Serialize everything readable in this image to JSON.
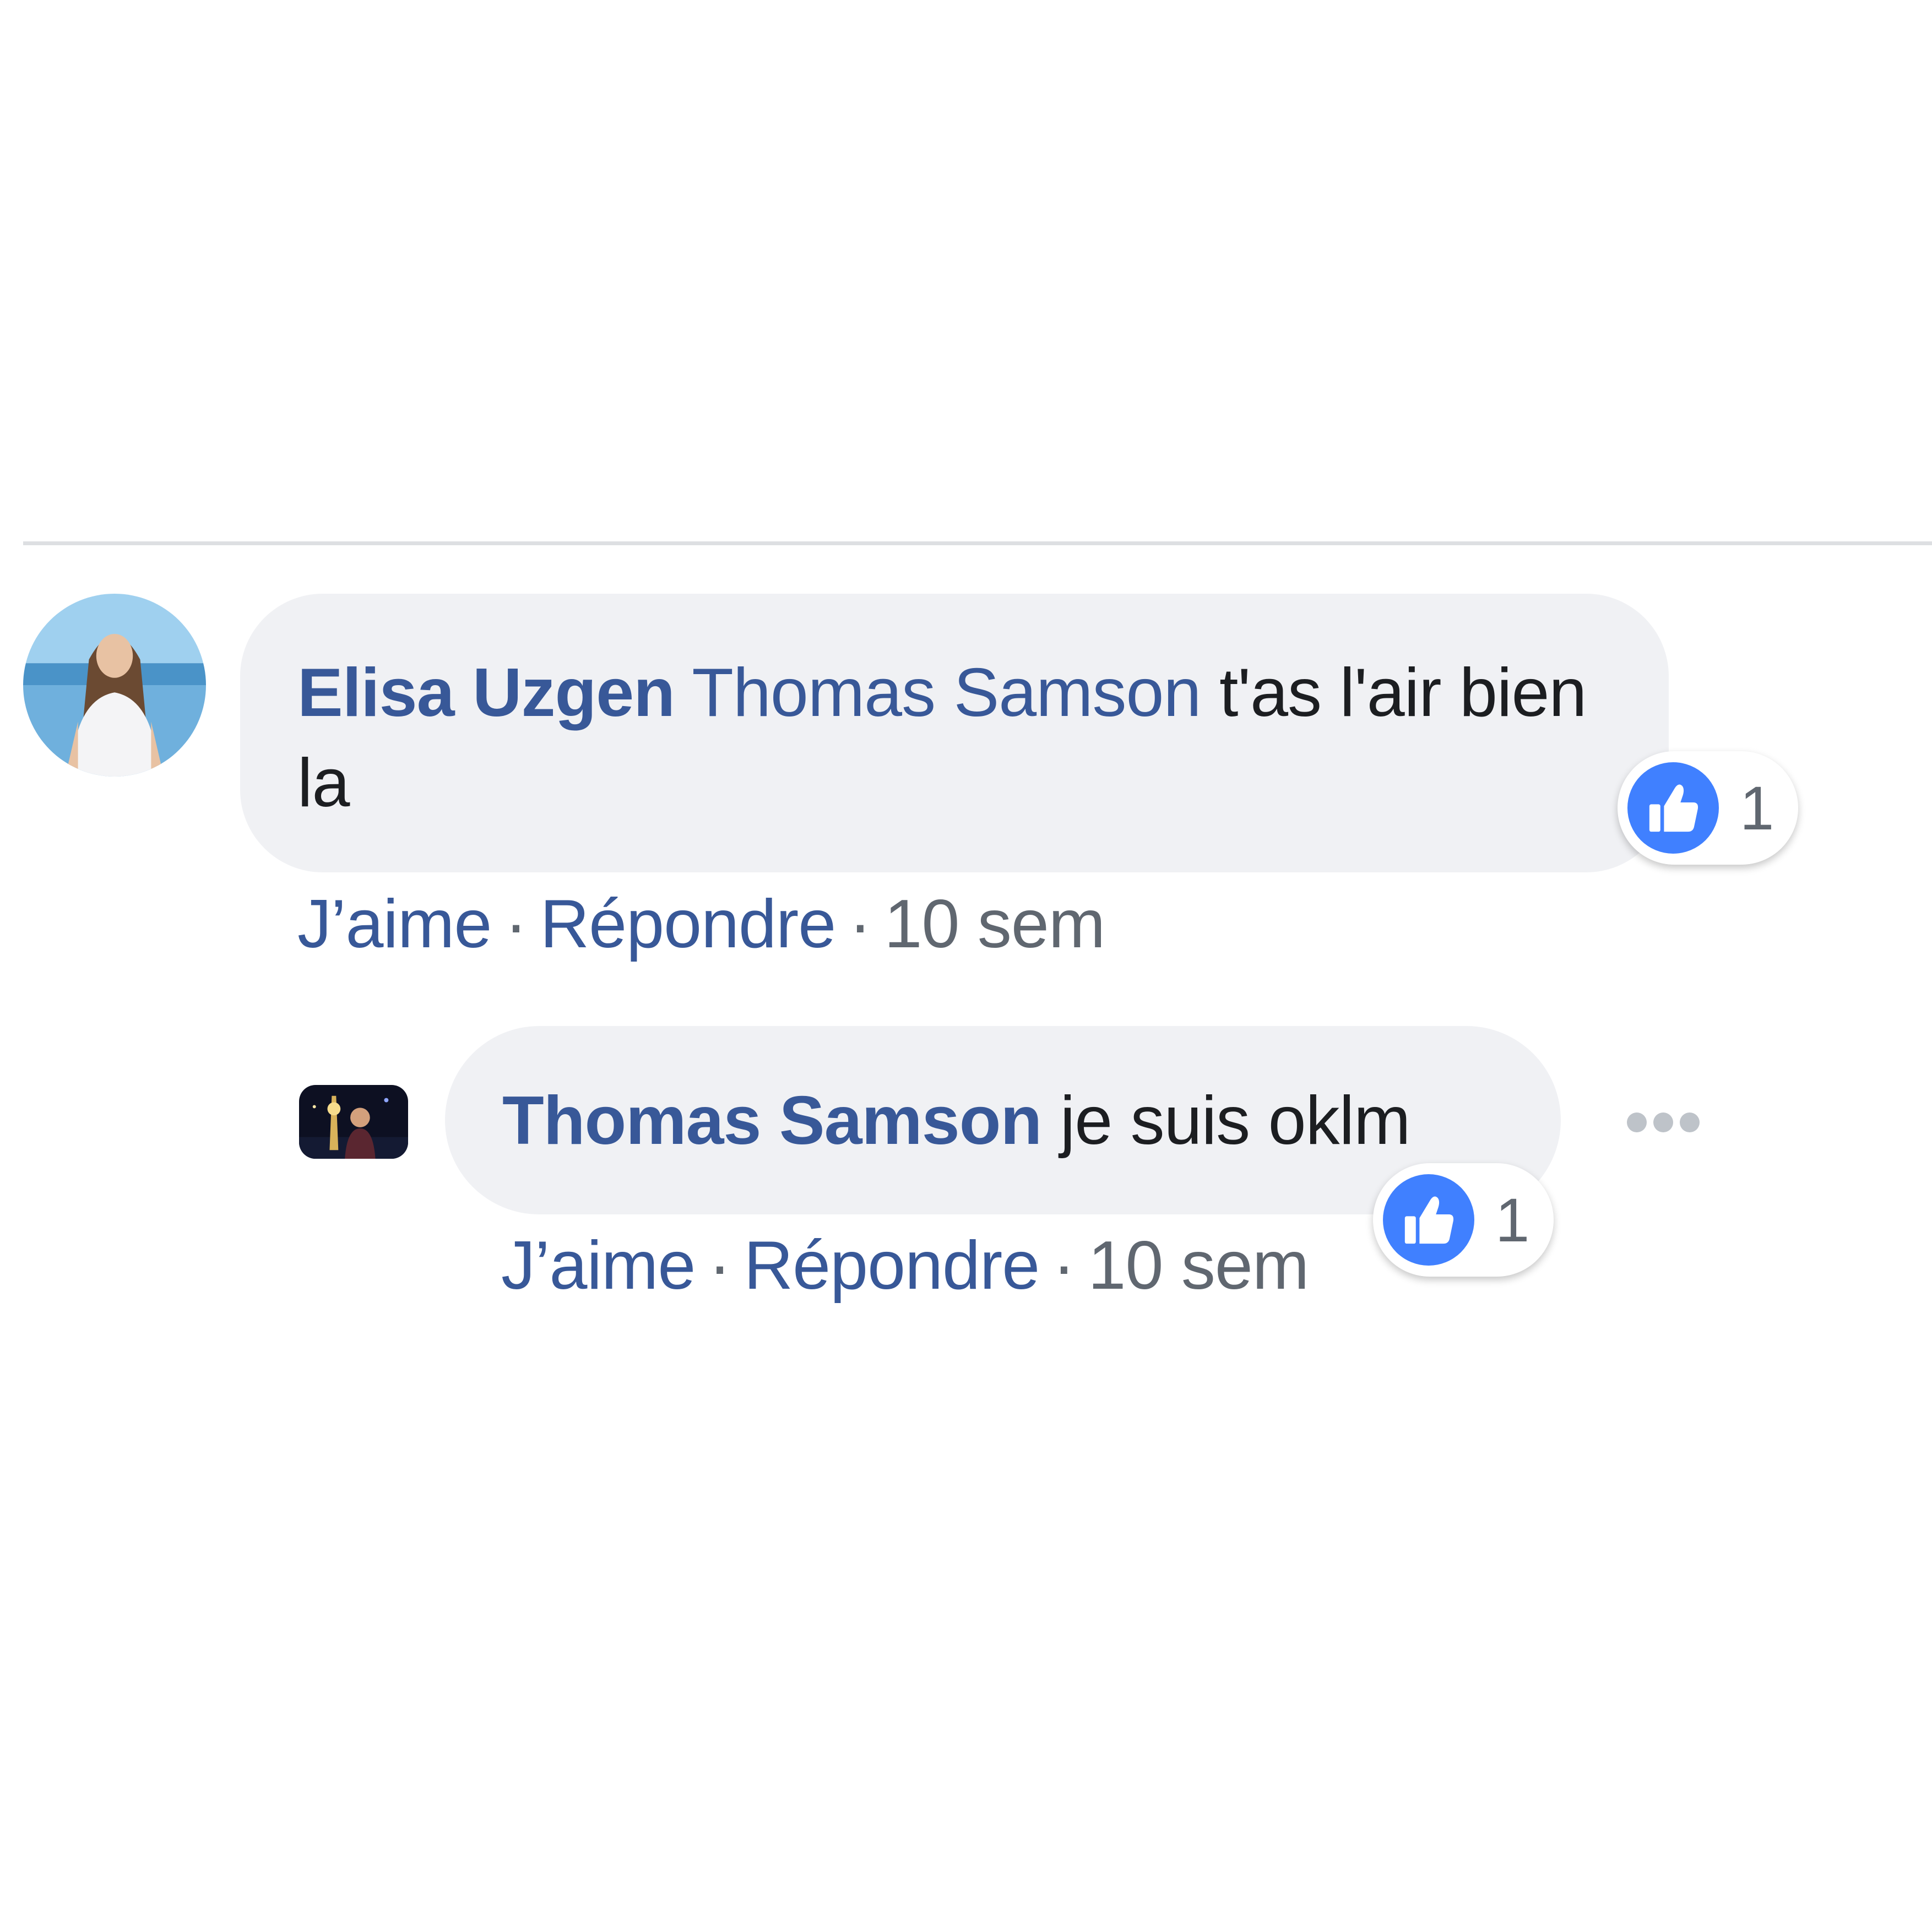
{
  "colors": {
    "link_blue": "#385898",
    "like_blue": "#4080ff",
    "bubble_bg": "#f0f1f4",
    "meta_gray": "#606770",
    "divider": "#dddfe2"
  },
  "comments": [
    {
      "author": "Elisa Uzgen",
      "mention": "Thomas Samson",
      "text": "t'as l'air bien la",
      "avatar_icon": "profile-photo-beach",
      "actions": {
        "like": "J’aime",
        "separator": "·",
        "reply": "Répondre",
        "time": "10 sem"
      },
      "reaction": {
        "icon": "thumbs-up-icon",
        "count": "1"
      }
    },
    {
      "author": "Thomas Samson",
      "text": "je suis oklm",
      "avatar_icon": "profile-photo-night",
      "actions": {
        "like": "J’aime",
        "separator": "·",
        "reply": "Répondre",
        "time": "10 sem"
      },
      "reaction": {
        "icon": "thumbs-up-icon",
        "count": "1"
      },
      "more_icon": "more-options-icon"
    }
  ]
}
